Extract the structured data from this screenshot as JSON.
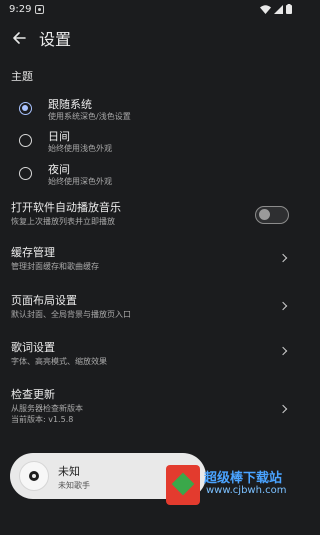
{
  "status_bar": {
    "time": "9:29"
  },
  "header": {
    "title": "设置"
  },
  "theme_section": {
    "title": "主题",
    "options": [
      {
        "label": "跟随系统",
        "desc": "使用系统深色/浅色设置",
        "selected": true
      },
      {
        "label": "日间",
        "desc": "始终使用浅色外观",
        "selected": false
      },
      {
        "label": "夜间",
        "desc": "始终使用深色外观",
        "selected": false
      }
    ]
  },
  "settings": {
    "autoplay": {
      "title": "打开软件自动播放音乐",
      "desc": "恢复上次播放列表并立即播放",
      "enabled": false
    },
    "cache": {
      "title": "缓存管理",
      "desc": "管理封面缓存和歌曲缓存"
    },
    "layout": {
      "title": "页面布局设置",
      "desc": "默认封面、全局背景与播放页入口"
    },
    "lyrics": {
      "title": "歌词设置",
      "desc": "字体、高亮模式、缩放效果"
    },
    "update": {
      "title": "检查更新",
      "desc": "从服务器检查新版本",
      "version": "当前版本: v1.5.8"
    }
  },
  "mini_player": {
    "title": "未知",
    "artist": "未知歌手"
  },
  "watermark": {
    "title": "超级棒下载站",
    "url": "www.cjbwh.com"
  },
  "colors": {
    "background": "#1b1c1e",
    "accent": "#a9c3ff"
  }
}
